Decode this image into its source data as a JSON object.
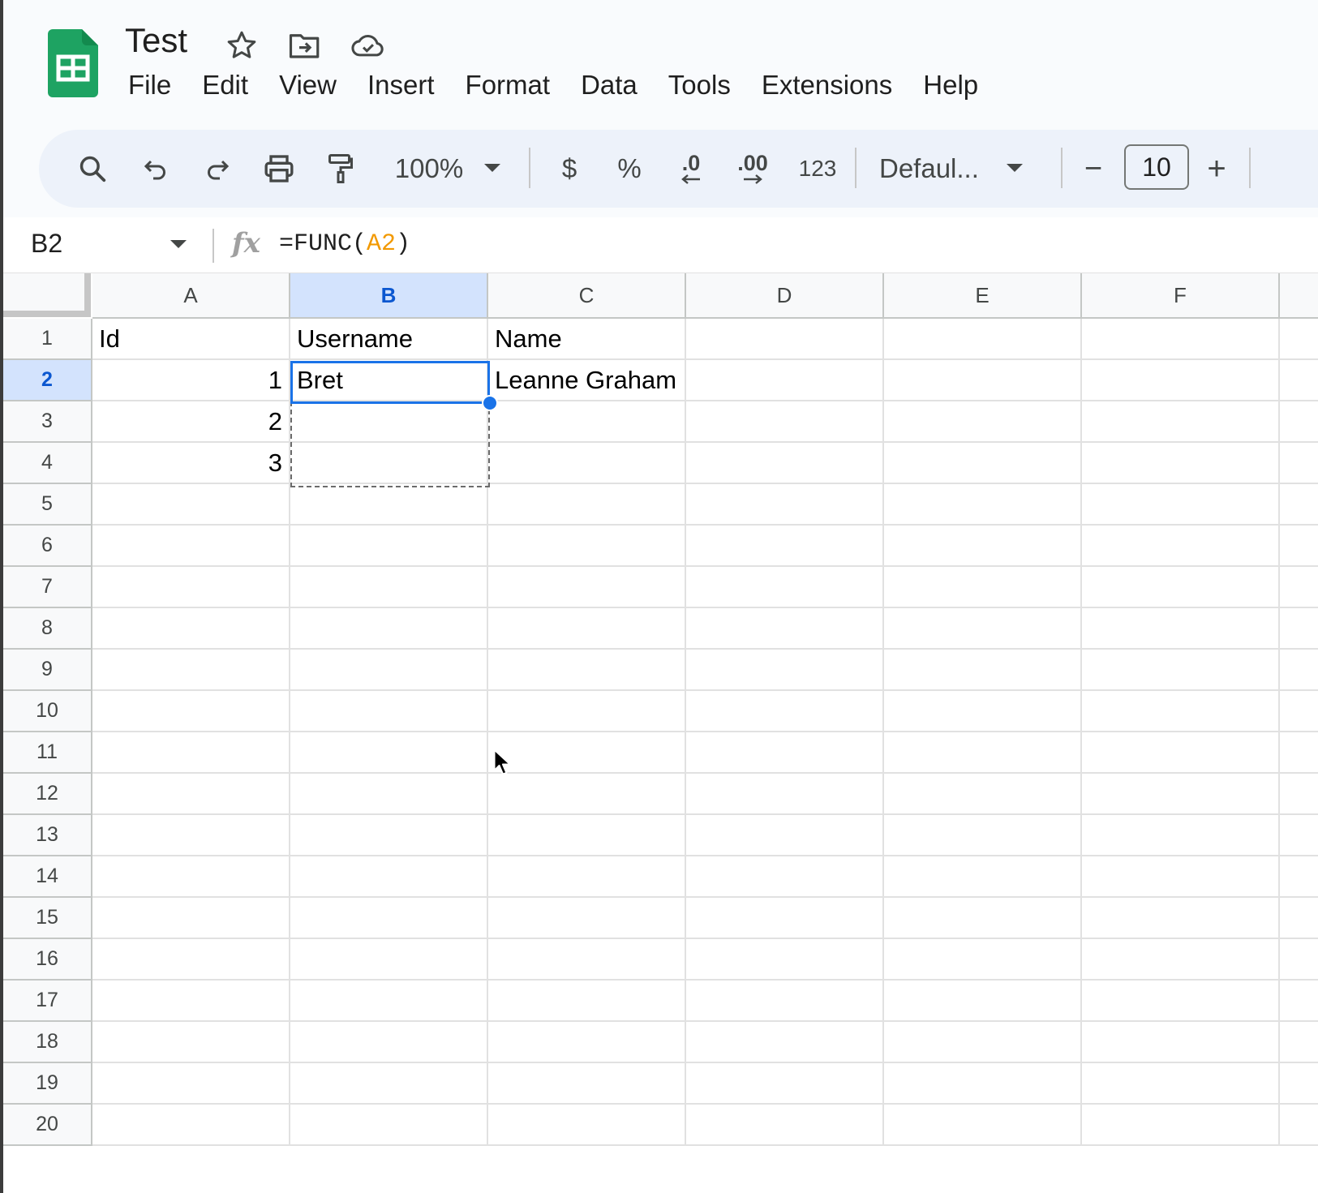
{
  "app": {
    "title": "Test"
  },
  "menu": [
    "File",
    "Edit",
    "View",
    "Insert",
    "Format",
    "Data",
    "Tools",
    "Extensions",
    "Help"
  ],
  "toolbar": {
    "zoom": "100%",
    "currency": "$",
    "percent": "%",
    "decrease_decimal": ".0",
    "increase_decimal": ".00",
    "number_format": "123",
    "font": "Defaul...",
    "font_size": "10",
    "minus": "−",
    "plus": "+"
  },
  "formula_bar": {
    "cell_ref": "B2",
    "fx": "fx",
    "formula_prefix": "=FUNC(",
    "formula_ref": "A2",
    "formula_suffix": ")"
  },
  "grid": {
    "columns": [
      "A",
      "B",
      "C",
      "D",
      "E",
      "F"
    ],
    "rows": [
      "1",
      "2",
      "3",
      "4",
      "5",
      "6",
      "7",
      "8",
      "9",
      "10",
      "11",
      "12",
      "13",
      "14",
      "15",
      "16",
      "17",
      "18",
      "19",
      "20"
    ],
    "selected_column": "B",
    "selected_row": "2",
    "cells": {
      "A1": "Id",
      "B1": "Username",
      "C1": "Name",
      "A2": "1",
      "B2": "Bret",
      "C2": "Leanne Graham",
      "A3": "2",
      "A4": "3"
    }
  }
}
